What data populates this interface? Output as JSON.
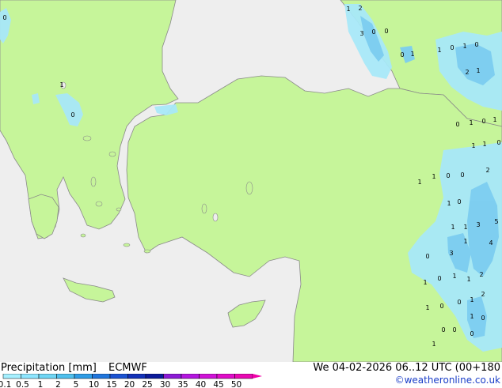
{
  "footer": {
    "title": "Precipitation [mm]",
    "model": "ECMWF",
    "datetime": "We 04-02-2026 06..12 UTC (00+180",
    "credit": "©weatheronline.co.uk"
  },
  "legend": {
    "ticks": [
      "0.1",
      "0.5",
      "1",
      "2",
      "5",
      "10",
      "15",
      "20",
      "25",
      "30",
      "35",
      "40",
      "45",
      "50"
    ],
    "colors": [
      "#a6f0ff",
      "#8ee6ff",
      "#6fd6f5",
      "#4fc0ee",
      "#2e9ce6",
      "#2076dd",
      "#1a52d2",
      "#1231b8",
      "#0b1a9a",
      "#8c1ad6",
      "#b415e0",
      "#d012d8",
      "#e00cc8",
      "#e908b3"
    ]
  },
  "map": {
    "colors": {
      "land": "#c6f59a",
      "sea": "#eeeeee",
      "coast": "#8a8a8a",
      "rain_light": "#a8e8f8",
      "rain_mid": "#7ccdf0"
    },
    "labels": [
      {
        "t": "1"
      },
      {
        "t": "2"
      },
      {
        "t": "3"
      },
      {
        "t": "0"
      },
      {
        "t": "0"
      },
      {
        "t": "0"
      },
      {
        "t": "1"
      },
      {
        "t": "1"
      },
      {
        "t": "0"
      },
      {
        "t": "1"
      },
      {
        "t": "0"
      },
      {
        "t": "0"
      },
      {
        "t": "2"
      },
      {
        "t": "1"
      },
      {
        "t": "1"
      },
      {
        "t": "0"
      },
      {
        "t": "0"
      },
      {
        "t": "1"
      },
      {
        "t": "0"
      },
      {
        "t": "1"
      },
      {
        "t": "1"
      },
      {
        "t": "1"
      },
      {
        "t": "0"
      },
      {
        "t": "2"
      },
      {
        "t": "1"
      },
      {
        "t": "1"
      },
      {
        "t": "0"
      },
      {
        "t": "0"
      },
      {
        "t": "1"
      },
      {
        "t": "0"
      },
      {
        "t": "1"
      },
      {
        "t": "1"
      },
      {
        "t": "3"
      },
      {
        "t": "1"
      },
      {
        "t": "4"
      },
      {
        "t": "5"
      },
      {
        "t": "0"
      },
      {
        "t": "3"
      },
      {
        "t": "2"
      },
      {
        "t": "1"
      },
      {
        "t": "0"
      },
      {
        "t": "1"
      },
      {
        "t": "1"
      },
      {
        "t": "2"
      },
      {
        "t": "1"
      },
      {
        "t": "0"
      },
      {
        "t": "0"
      },
      {
        "t": "1"
      },
      {
        "t": "1"
      },
      {
        "t": "0"
      },
      {
        "t": "0"
      },
      {
        "t": "0"
      },
      {
        "t": "1"
      },
      {
        "t": "0"
      }
    ]
  }
}
